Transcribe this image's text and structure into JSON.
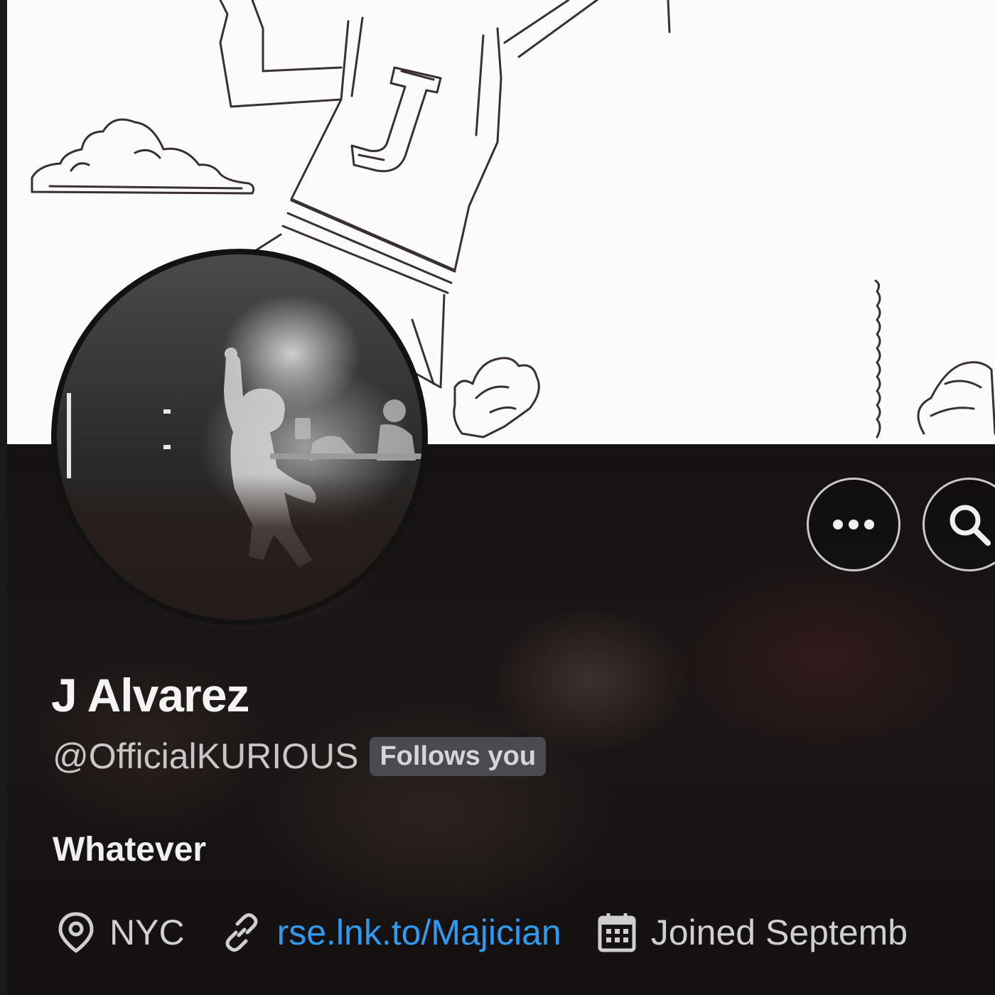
{
  "profile": {
    "display_name": "J Alvarez",
    "handle": "@OfficialKURIOUS",
    "follows_badge": "Follows you",
    "bio": "Whatever",
    "location": "NYC",
    "website": "rse.lnk.to/Majician",
    "joined": "Joined Septemb"
  },
  "actions": {
    "more_icon": "more-horizontal-icon",
    "search_icon": "search-icon"
  },
  "colors": {
    "background": "#121010",
    "banner": "#fbfbfb",
    "link": "#2f9bf0",
    "badge_bg": "#4a4b52",
    "text_primary": "#f4f4f4",
    "text_secondary": "#c7c7c7"
  },
  "meta_icons": {
    "location": "map-pin-icon",
    "website": "link-icon",
    "joined": "calendar-icon"
  }
}
